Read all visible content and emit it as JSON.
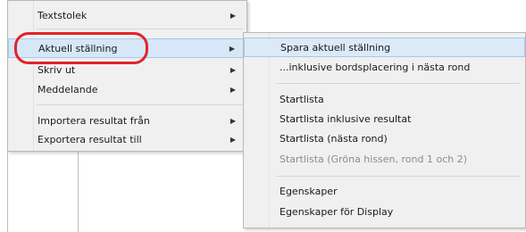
{
  "left_menu": {
    "items": [
      {
        "label": "Textstolek",
        "arrow": "▶"
      },
      {
        "label": "Aktuell ställning",
        "arrow": "▶"
      },
      {
        "label": "Skriv ut",
        "arrow": "▶"
      },
      {
        "label": "Meddelande",
        "arrow": "▶"
      },
      {
        "label": "Importera resultat från",
        "arrow": "▶"
      },
      {
        "label": "Exportera resultat till",
        "arrow": "▶"
      }
    ]
  },
  "submenu": {
    "items": [
      {
        "label": "Spara aktuell ställning"
      },
      {
        "label": "...inklusive bordsplacering i nästa rond"
      },
      {
        "label": "Startlista"
      },
      {
        "label": "Startlista inklusive resultat"
      },
      {
        "label": "Startlista (nästa rond)"
      },
      {
        "label": "Startlista (Gröna hissen, rond 1 och 2)"
      },
      {
        "label": "Egenskaper"
      },
      {
        "label": "Egenskaper för Display"
      }
    ]
  },
  "colors": {
    "highlight": "#d6e7f8",
    "annotation": "#e0232b",
    "disabled_text": "#8c8c8c"
  }
}
